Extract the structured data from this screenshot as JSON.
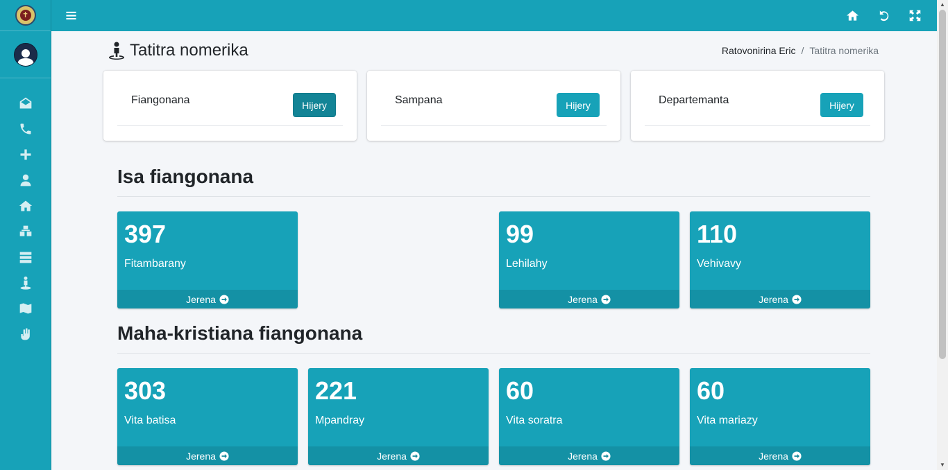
{
  "page": {
    "title": "Tatitra nomerika",
    "breadcrumb": [
      "Ratovonirina Eric",
      "Tatitra nomerika"
    ]
  },
  "sidebar": {
    "items": [
      {
        "icon": "envelope-open-icon"
      },
      {
        "icon": "phone-icon"
      },
      {
        "icon": "plus-icon"
      },
      {
        "icon": "user-icon"
      },
      {
        "icon": "home-icon"
      },
      {
        "icon": "cubes-icon"
      },
      {
        "icon": "server-icon"
      },
      {
        "icon": "person-pin-icon"
      },
      {
        "icon": "map-icon"
      },
      {
        "icon": "hand-icon"
      }
    ]
  },
  "filters": [
    {
      "label": "Fiangonana",
      "button": "Hijery"
    },
    {
      "label": "Sampana",
      "button": "Hijery"
    },
    {
      "label": "Departemanta",
      "button": "Hijery"
    }
  ],
  "sections": [
    {
      "title": "Isa fiangonana",
      "boxes": [
        {
          "value": "397",
          "label": "Fitambarany",
          "link": "Jerena"
        },
        {
          "value": "99",
          "label": "Lehilahy",
          "link": "Jerena"
        },
        {
          "value": "110",
          "label": "Vehivavy",
          "link": "Jerena"
        }
      ]
    },
    {
      "title": "Maha-kristiana fiangonana",
      "boxes": [
        {
          "value": "303",
          "label": "Vita batisa",
          "link": "Jerena"
        },
        {
          "value": "221",
          "label": "Mpandray",
          "link": "Jerena"
        },
        {
          "value": "60",
          "label": "Vita soratra",
          "link": "Jerena"
        },
        {
          "value": "60",
          "label": "Vita mariazy",
          "link": "Jerena"
        }
      ]
    }
  ],
  "colors": {
    "accent": "#17a2b8",
    "background": "#f4f6f9"
  }
}
